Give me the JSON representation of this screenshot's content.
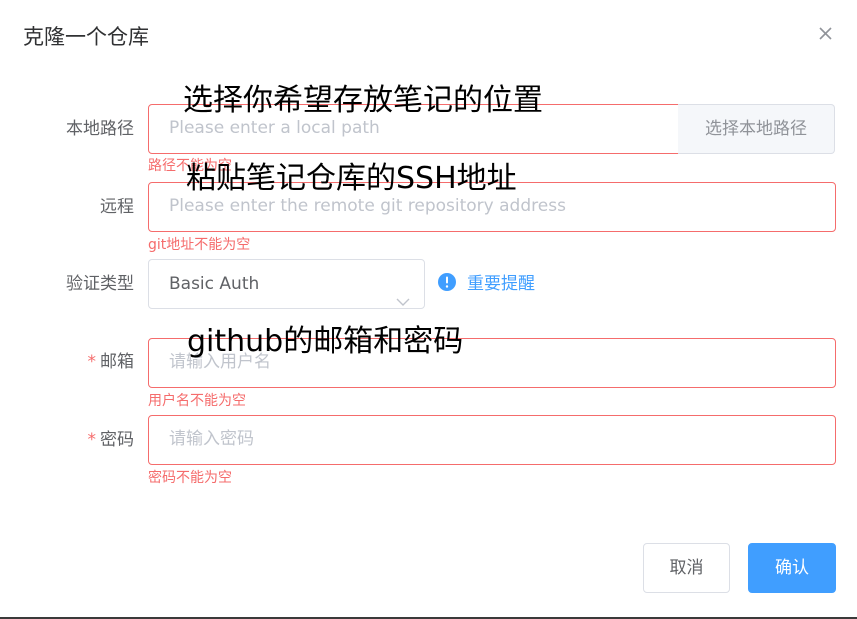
{
  "dialog": {
    "title": "克隆一个仓库",
    "close_icon": "close-icon"
  },
  "fields": {
    "local_path": {
      "label": "本地路径",
      "placeholder": "Please enter a local path",
      "append_label": "选择本地路径",
      "error": "路径不能为空"
    },
    "remote": {
      "label": "远程",
      "placeholder": "Please enter the remote git repository address",
      "error": "git地址不能为空"
    },
    "auth_type": {
      "label": "验证类型",
      "value": "Basic Auth",
      "reminder_icon": "exclamation-circle-icon",
      "reminder_label": "重要提醒"
    },
    "email": {
      "required_mark": "*",
      "label": "邮箱",
      "placeholder": "请输入用户名",
      "error": "用户名不能为空"
    },
    "password": {
      "required_mark": "*",
      "label": "密码",
      "placeholder": "请输入密码",
      "error": "密码不能为空"
    }
  },
  "annotations": {
    "local_path": "选择你希望存放笔记的位置",
    "remote": "粘贴笔记仓库的SSH地址",
    "credentials": "github的邮箱和密码"
  },
  "footer": {
    "cancel_label": "取消",
    "confirm_label": "确认"
  },
  "colors": {
    "error": "#f56c6c",
    "primary": "#409eff",
    "text": "#606266",
    "placeholder": "#c0c4cc"
  }
}
